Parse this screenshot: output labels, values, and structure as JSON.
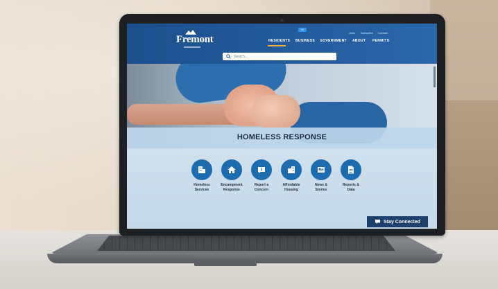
{
  "site": {
    "logo_text": "Fremont",
    "top_badge": "EN",
    "util_links": [
      "Jobs",
      "Subscribe",
      "Contact"
    ],
    "nav": [
      "RESIDENTS",
      "BUSINESS",
      "GOVERNMENT",
      "ABOUT",
      "PERMITS"
    ],
    "search_placeholder": "Search..."
  },
  "hero": {
    "title": "HOMELESS RESPONSE"
  },
  "tiles": [
    {
      "icon": "building-icon",
      "line1": "Homeless",
      "line2": "Services"
    },
    {
      "icon": "house-icon",
      "line1": "Encampment",
      "line2": "Response"
    },
    {
      "icon": "report-icon",
      "line1": "Report a",
      "line2": "Concern"
    },
    {
      "icon": "affordable-housing-icon",
      "line1": "Affordable",
      "line2": "Housing"
    },
    {
      "icon": "news-icon",
      "line1": "News &",
      "line2": "Stories"
    },
    {
      "icon": "document-icon",
      "line1": "Reports &",
      "line2": "Data"
    }
  ],
  "stay_connected": "Stay Connected",
  "colors": {
    "header_blue": "#1c4f8c",
    "icon_blue": "#1e6cb0",
    "button_navy": "#1d3f6e",
    "accent": "#f0b23a"
  }
}
